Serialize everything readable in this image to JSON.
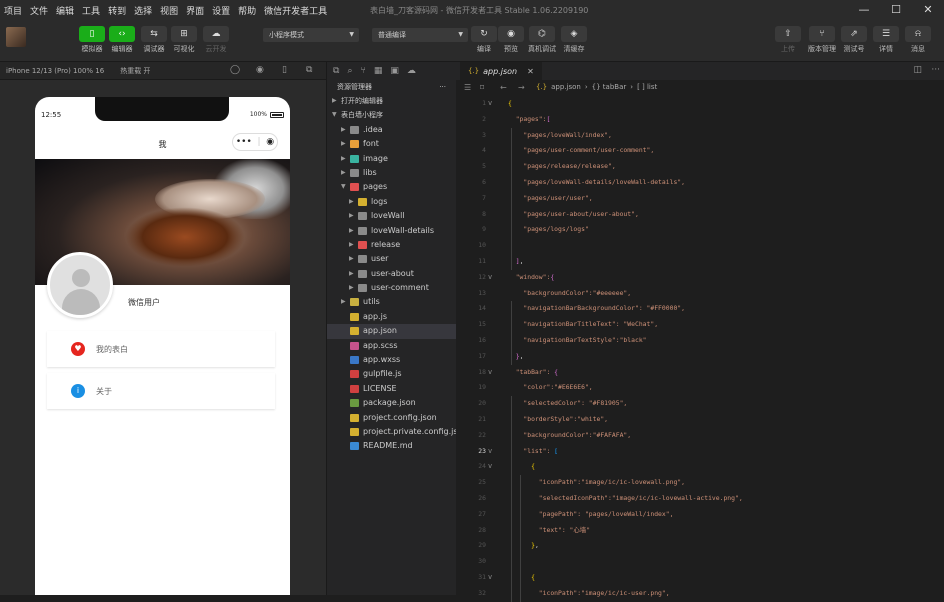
{
  "menu": [
    "项目",
    "文件",
    "编辑",
    "工具",
    "转到",
    "选择",
    "视图",
    "界面",
    "设置",
    "帮助",
    "微信开发者工具"
  ],
  "window_title": "表白墙_刀客源码网 - 微信开发者工具 Stable 1.06.2209190",
  "toolbar": {
    "left_buttons": [
      "模拟器",
      "编辑器",
      "调试器",
      "可视化",
      "云开发"
    ],
    "mode_select": "小程序模式",
    "compile_select": "普通编译",
    "mid_buttons": [
      "编译",
      "预览",
      "真机调试",
      "清缓存"
    ],
    "right_buttons": [
      "上传",
      "版本管理",
      "测试号",
      "详情",
      "消息"
    ]
  },
  "simulator": {
    "device": "iPhone 12/13 (Pro) 100% 16",
    "hotreload": "热重载 开",
    "time": "12:55",
    "battery": "100%",
    "nav_title": "我",
    "capsule_dots": "•••",
    "user_name": "微信用户",
    "cards": [
      {
        "label": "我的表白",
        "icon": "heart-icon",
        "color": "#e5261f"
      },
      {
        "label": "关于",
        "icon": "info-icon",
        "color": "#1a8fe3"
      }
    ]
  },
  "explorer": {
    "header": "资源管理器",
    "open_editors": "打开的编辑器",
    "project": "表白墙小程序",
    "items": [
      {
        "name": ".idea",
        "type": "folder",
        "depth": 1,
        "color": "#8a8a8a"
      },
      {
        "name": "font",
        "type": "folder",
        "depth": 1,
        "color": "#e8a03a"
      },
      {
        "name": "image",
        "type": "folder",
        "depth": 1,
        "color": "#3ab4a0"
      },
      {
        "name": "libs",
        "type": "folder",
        "depth": 1,
        "color": "#8a8a8a"
      },
      {
        "name": "pages",
        "type": "folder-open",
        "depth": 1,
        "color": "#e05050"
      },
      {
        "name": "logs",
        "type": "folder",
        "depth": 2,
        "color": "#d4b030"
      },
      {
        "name": "loveWall",
        "type": "folder",
        "depth": 2,
        "color": "#8a8a8a"
      },
      {
        "name": "loveWall-details",
        "type": "folder",
        "depth": 2,
        "color": "#8a8a8a"
      },
      {
        "name": "release",
        "type": "folder",
        "depth": 2,
        "color": "#e05050"
      },
      {
        "name": "user",
        "type": "folder",
        "depth": 2,
        "color": "#8a8a8a"
      },
      {
        "name": "user-about",
        "type": "folder",
        "depth": 2,
        "color": "#8a8a8a"
      },
      {
        "name": "user-comment",
        "type": "folder",
        "depth": 2,
        "color": "#8a8a8a"
      },
      {
        "name": "utils",
        "type": "folder",
        "depth": 1,
        "color": "#c8b040"
      },
      {
        "name": "app.js",
        "type": "file",
        "depth": 1,
        "color": "#d4b030"
      },
      {
        "name": "app.json",
        "type": "file",
        "depth": 1,
        "color": "#d4b030",
        "selected": true
      },
      {
        "name": "app.scss",
        "type": "file",
        "depth": 1,
        "color": "#c6538c"
      },
      {
        "name": "app.wxss",
        "type": "file",
        "depth": 1,
        "color": "#3a78c8"
      },
      {
        "name": "gulpfile.js",
        "type": "file",
        "depth": 1,
        "color": "#d04040"
      },
      {
        "name": "LICENSE",
        "type": "file",
        "depth": 1,
        "color": "#d04040"
      },
      {
        "name": "package.json",
        "type": "file",
        "depth": 1,
        "color": "#6a9a40"
      },
      {
        "name": "project.config.json",
        "type": "file",
        "depth": 1,
        "color": "#d4b030"
      },
      {
        "name": "project.private.config.js...",
        "type": "file",
        "depth": 1,
        "color": "#d4b030"
      },
      {
        "name": "README.md",
        "type": "file",
        "depth": 1,
        "color": "#3a8ad4"
      }
    ]
  },
  "editor": {
    "tab": "app.json",
    "breadcrumb": [
      "app.json",
      "{} tabBar",
      "[ ] list"
    ],
    "current_line": "23",
    "lines": [
      {
        "n": "1",
        "fold": "v",
        "t": [
          [
            "{",
            "b"
          ]
        ]
      },
      {
        "n": "2",
        "t": [
          [
            "  \"pages\":",
            "k"
          ],
          [
            "[",
            "b2"
          ]
        ]
      },
      {
        "n": "3",
        "t": [
          [
            "    \"pages/loveWall/index\",",
            "k"
          ]
        ]
      },
      {
        "n": "4",
        "t": [
          [
            "    \"pages/user-comment/user-comment\",",
            "k"
          ]
        ]
      },
      {
        "n": "5",
        "t": [
          [
            "    \"pages/release/release\",",
            "k"
          ]
        ]
      },
      {
        "n": "6",
        "t": [
          [
            "    \"pages/loveWall-details/loveWall-details\",",
            "k"
          ]
        ]
      },
      {
        "n": "7",
        "t": [
          [
            "    \"pages/user/user\",",
            "k"
          ]
        ]
      },
      {
        "n": "8",
        "t": [
          [
            "    \"pages/user-about/user-about\",",
            "k"
          ]
        ]
      },
      {
        "n": "9",
        "t": [
          [
            "    \"pages/logs/logs\"",
            "k"
          ]
        ]
      },
      {
        "n": "10",
        "t": [
          [
            "",
            "p"
          ]
        ]
      },
      {
        "n": "11",
        "t": [
          [
            "  ",
            "p"
          ],
          [
            "]",
            "b2"
          ],
          [
            ",",
            "p"
          ]
        ]
      },
      {
        "n": "12",
        "fold": "v",
        "t": [
          [
            "  \"window\":",
            "k"
          ],
          [
            "{",
            "b2"
          ]
        ]
      },
      {
        "n": "13",
        "t": [
          [
            "    \"backgroundColor\":\"#eeeeee\",",
            "k"
          ]
        ]
      },
      {
        "n": "14",
        "t": [
          [
            "    \"navigationBarBackgroundColor\": \"#FF0000\",",
            "k"
          ]
        ]
      },
      {
        "n": "15",
        "t": [
          [
            "    \"navigationBarTitleText\": \"WeChat\",",
            "k"
          ]
        ]
      },
      {
        "n": "16",
        "t": [
          [
            "    \"navigationBarTextStyle\":\"black\"",
            "k"
          ]
        ]
      },
      {
        "n": "17",
        "t": [
          [
            "  ",
            "p"
          ],
          [
            "}",
            "b2"
          ],
          [
            ",",
            "p"
          ]
        ]
      },
      {
        "n": "18",
        "fold": "v",
        "t": [
          [
            "  \"tabBar\": ",
            "k"
          ],
          [
            "{",
            "b2"
          ]
        ]
      },
      {
        "n": "19",
        "t": [
          [
            "    \"color\":\"#E6E6E6\",",
            "k"
          ]
        ]
      },
      {
        "n": "20",
        "t": [
          [
            "    \"selectedColor\": \"#F81905\",",
            "k"
          ]
        ]
      },
      {
        "n": "21",
        "t": [
          [
            "    \"borderStyle\":\"white\",",
            "k"
          ]
        ]
      },
      {
        "n": "22",
        "t": [
          [
            "    \"backgroundColor\":\"#FAFAFA\",",
            "k"
          ]
        ]
      },
      {
        "n": "23",
        "fold": "v",
        "t": [
          [
            "    \"list\": ",
            "k"
          ],
          [
            "[",
            "b3"
          ]
        ]
      },
      {
        "n": "24",
        "fold": "v",
        "t": [
          [
            "      {",
            "b"
          ]
        ]
      },
      {
        "n": "25",
        "t": [
          [
            "        \"iconPath\":\"image/ic/ic-lovewall.png\",",
            "k"
          ]
        ]
      },
      {
        "n": "26",
        "t": [
          [
            "        \"selectedIconPath\":\"image/ic/ic-lovewall-active.png\",",
            "k"
          ]
        ]
      },
      {
        "n": "27",
        "t": [
          [
            "        \"pagePath\": \"pages/loveWall/index\",",
            "k"
          ]
        ]
      },
      {
        "n": "28",
        "t": [
          [
            "        \"text\": \"心墙\"",
            "k"
          ]
        ]
      },
      {
        "n": "29",
        "t": [
          [
            "      ",
            "p"
          ],
          [
            "}",
            "b"
          ],
          [
            ",",
            "p"
          ]
        ]
      },
      {
        "n": "30",
        "t": [
          [
            "",
            "p"
          ]
        ]
      },
      {
        "n": "31",
        "fold": "v",
        "t": [
          [
            "      {",
            "b"
          ]
        ]
      },
      {
        "n": "32",
        "t": [
          [
            "        \"iconPath\":\"image/ic/ic-user.png\",",
            "k"
          ]
        ]
      }
    ]
  }
}
